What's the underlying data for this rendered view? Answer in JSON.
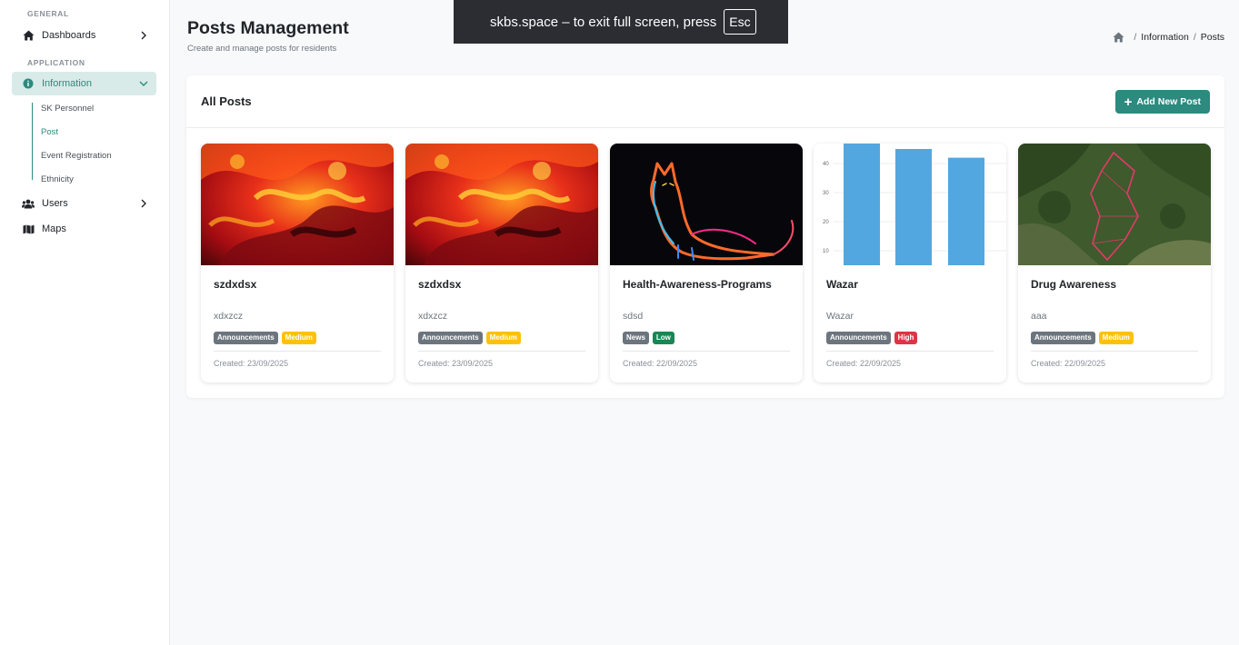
{
  "sidebar": {
    "general_label": "GENERAL",
    "application_label": "APPLICATION",
    "dashboards": "Dashboards",
    "information": "Information",
    "sub_items": [
      "SK Personnel",
      "Post",
      "Event Registration",
      "Ethnicity"
    ],
    "users": "Users",
    "maps": "Maps"
  },
  "header": {
    "title": "Posts Management",
    "subtitle": "Create and manage posts for residents",
    "breadcrumb": [
      "Information",
      "Posts"
    ]
  },
  "fullscreen": {
    "message": "skbs.space – to exit full screen, press",
    "key": "Esc"
  },
  "card": {
    "title": "All Posts",
    "add_button": "Add New Post"
  },
  "posts": [
    {
      "title": "szdxdsx",
      "desc": "xdxzcz",
      "category": "Announcements",
      "priority": "Medium",
      "date": "Created: 23/09/2025"
    },
    {
      "title": "szdxdsx",
      "desc": "xdxzcz",
      "category": "Announcements",
      "priority": "Medium",
      "date": "Created: 23/09/2025"
    },
    {
      "title": "Health-Awareness-Programs",
      "desc": "sdsd",
      "category": "News",
      "priority": "Low",
      "date": "Created: 22/09/2025"
    },
    {
      "title": "Wazar",
      "desc": "Wazar",
      "category": "Announcements",
      "priority": "High",
      "date": "Created: 22/09/2025"
    },
    {
      "title": "Drug Awareness",
      "desc": "aaa",
      "category": "Announcements",
      "priority": "Medium",
      "date": "Created: 22/09/2025"
    }
  ],
  "thumb_chart": {
    "ticks": [
      "40",
      "30",
      "20",
      "10"
    ],
    "values": [
      48,
      45,
      42
    ]
  },
  "colors": {
    "accent": "#2c8a7e",
    "category_badge": "#6c757d",
    "news_badge": "#6c757d",
    "medium": "#ffc107",
    "low": "#198754",
    "high": "#dc3545"
  }
}
